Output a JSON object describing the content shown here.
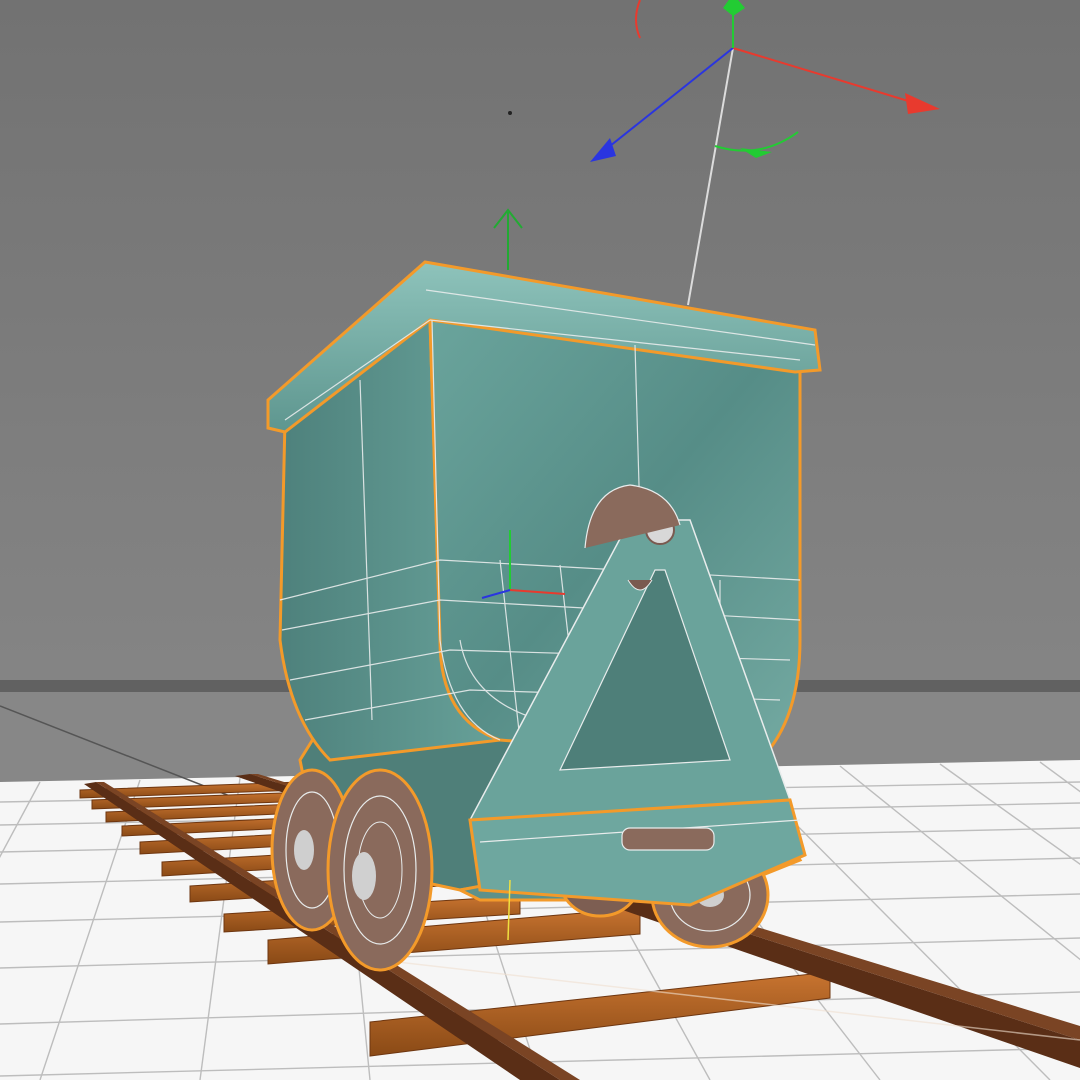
{
  "viewport": {
    "background_top": "#6f6f6f",
    "background_bottom": "#8e8e8e",
    "floor_color": "#f4f4f4",
    "grid_line_color": "#bdbdbd",
    "horizon_color": "#5e5e5e"
  },
  "selection": {
    "highlight_color": "#f39a2a",
    "wireframe_color": "#e8ecec"
  },
  "gizmo": {
    "x_axis_color": "#e83a2e",
    "y_axis_color": "#22cc33",
    "z_axis_color": "#2a35e0"
  },
  "scene": {
    "object": "mine-cart",
    "cart_color": "#5f9a94",
    "wheel_color": "#8a6a5c",
    "rail_color": "#5a2e16",
    "sleeper_color": "#b8641e"
  }
}
